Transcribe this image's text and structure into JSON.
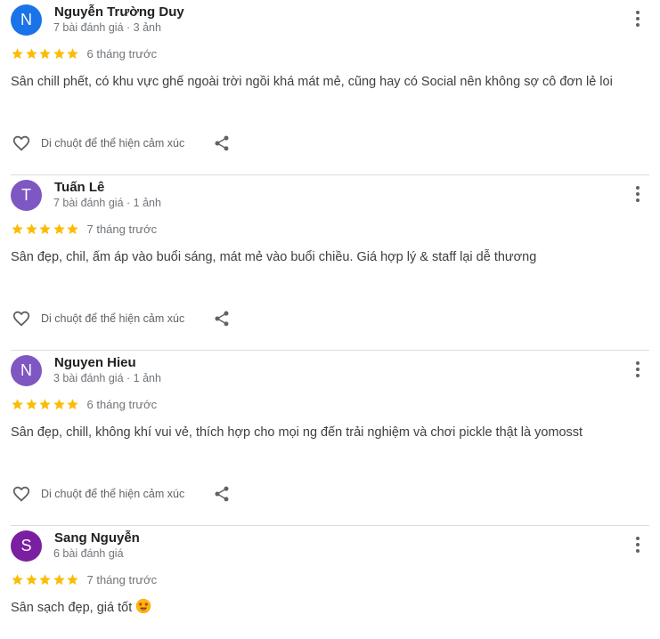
{
  "colors": {
    "star": "#fbbc04",
    "avatar_blue": "#1a73e8",
    "avatar_violet": "#7e57c2",
    "avatar_purple": "#7b1fa2",
    "icon": "#5f6368"
  },
  "icons": {
    "more": "more-vert-icon",
    "heart": "heart-outline-icon",
    "share": "share-icon",
    "star": "star-icon"
  },
  "reviews": [
    {
      "initial": "N",
      "avatar_color": "#1a73e8",
      "name": "Nguyễn Trường Duy",
      "meta": "7 bài đánh giá · 3 ảnh",
      "rating": 5,
      "date": "6 tháng trước",
      "text": "Sân chill phết, có khu vực ghế ngoài trời ngồi khá mát mẻ, cũng hay có Social nên không sợ cô đơn lẻ loi",
      "hint": "Di chuột để thể hiện cảm xúc"
    },
    {
      "initial": "T",
      "avatar_color": "#7e57c2",
      "name": "Tuấn Lê",
      "meta": "7 bài đánh giá · 1 ảnh",
      "rating": 5,
      "date": "7 tháng trước",
      "text": "Sân đẹp, chil, ấm áp vào buổi sáng, mát mẻ vào buổi chiều. Giá hợp lý & staff lại dễ thương",
      "hint": "Di chuột để thể hiện cảm xúc"
    },
    {
      "initial": "N",
      "avatar_color": "#7e57c2",
      "name": "Nguyen Hieu",
      "meta": "3 bài đánh giá · 1 ảnh",
      "rating": 5,
      "date": "6 tháng trước",
      "text": "Sân đẹp, chill, không khí vui vẻ, thích hợp cho mọi ng đến trải nghiệm và chơi pickle thật là yomosst",
      "hint": "Di chuột để thể hiện cảm xúc"
    },
    {
      "initial": "S",
      "avatar_color": "#7b1fa2",
      "name": "Sang Nguyễn",
      "meta": "6 bài đánh giá",
      "rating": 5,
      "date": "7 tháng trước",
      "text": "Sân sạch đẹp, giá tốt",
      "emoji": "heart-eyes-emoji"
    }
  ]
}
